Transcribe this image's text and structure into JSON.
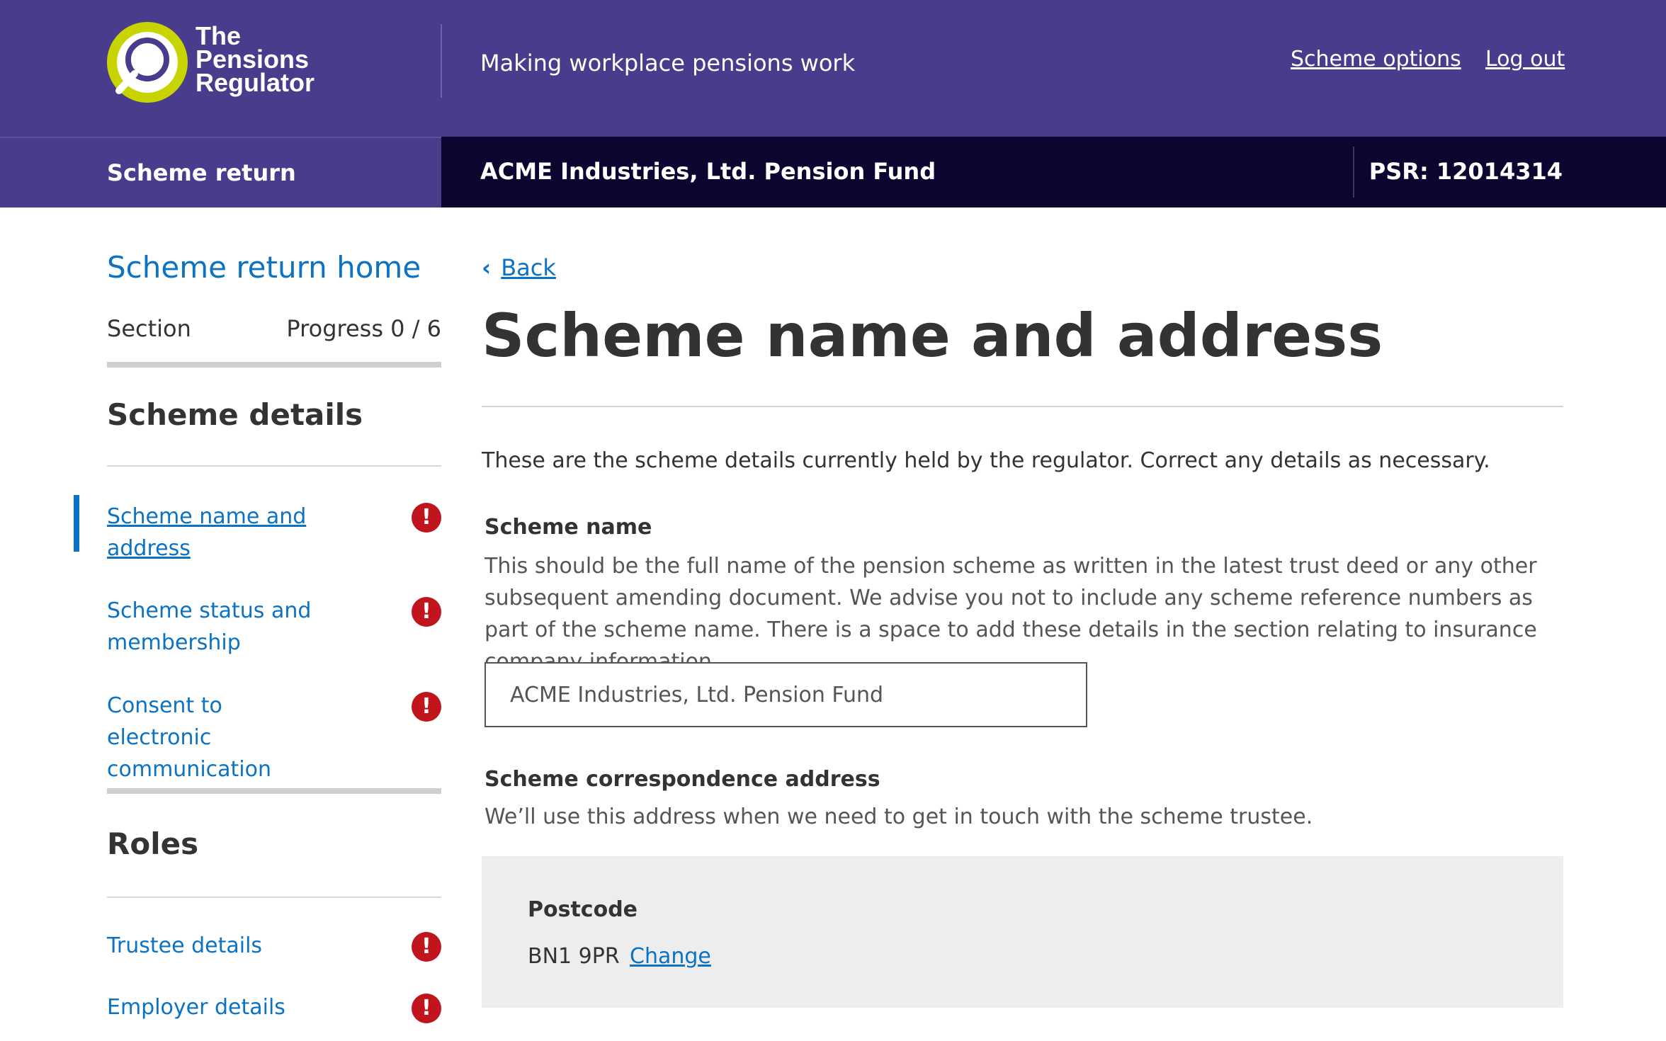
{
  "header": {
    "logo_lines": [
      "The",
      "Pensions",
      "Regulator"
    ],
    "tagline": "Making workplace pensions work",
    "links": {
      "scheme_options": "Scheme options",
      "log_out": "Log out"
    }
  },
  "subbar": {
    "section_title": "Scheme return",
    "scheme_name": "ACME Industries, Ltd. Pension Fund",
    "psr": "PSR: 12014314"
  },
  "sidebar": {
    "home_link": "Scheme return home",
    "section_label": "Section",
    "progress_label": "Progress 0 / 6",
    "groups": [
      {
        "heading": "Scheme details",
        "items": [
          {
            "label": "Scheme name and address",
            "status": "!",
            "active": true
          },
          {
            "label": "Scheme status and membership",
            "status": "!"
          },
          {
            "label": "Consent to electronic communication",
            "status": "!"
          }
        ]
      },
      {
        "heading": "Roles",
        "items": [
          {
            "label": "Trustee details",
            "status": "!"
          },
          {
            "label": "Employer details",
            "status": "!"
          }
        ]
      }
    ]
  },
  "main": {
    "back_label": "Back",
    "back_icon": "chevron-left-icon",
    "title": "Scheme name and address",
    "intro": "These are the scheme details currently held by the regulator. Correct any details as necessary.",
    "scheme_name": {
      "label": "Scheme name",
      "hint": "This should be the full name of the pension scheme as written in the latest trust deed or any other subsequent amending document. We advise you not to include any scheme reference numbers as part of the scheme name. There is a space to add these details in the section relating to insurance company information.",
      "value": "ACME Industries, Ltd. Pension Fund"
    },
    "correspondence": {
      "label": "Scheme correspondence address",
      "hint": "We’ll use this address when we need to get in touch with the scheme trustee.",
      "postcode_label": "Postcode",
      "postcode_value": "BN1 9PR",
      "change_label": "Change"
    }
  },
  "colors": {
    "header_purple": "#493c8c",
    "subbar_navy": "#0b06300",
    "link_blue": "#0b72c4",
    "alert_red": "#c0151d",
    "logo_lime": "#c8d400"
  }
}
